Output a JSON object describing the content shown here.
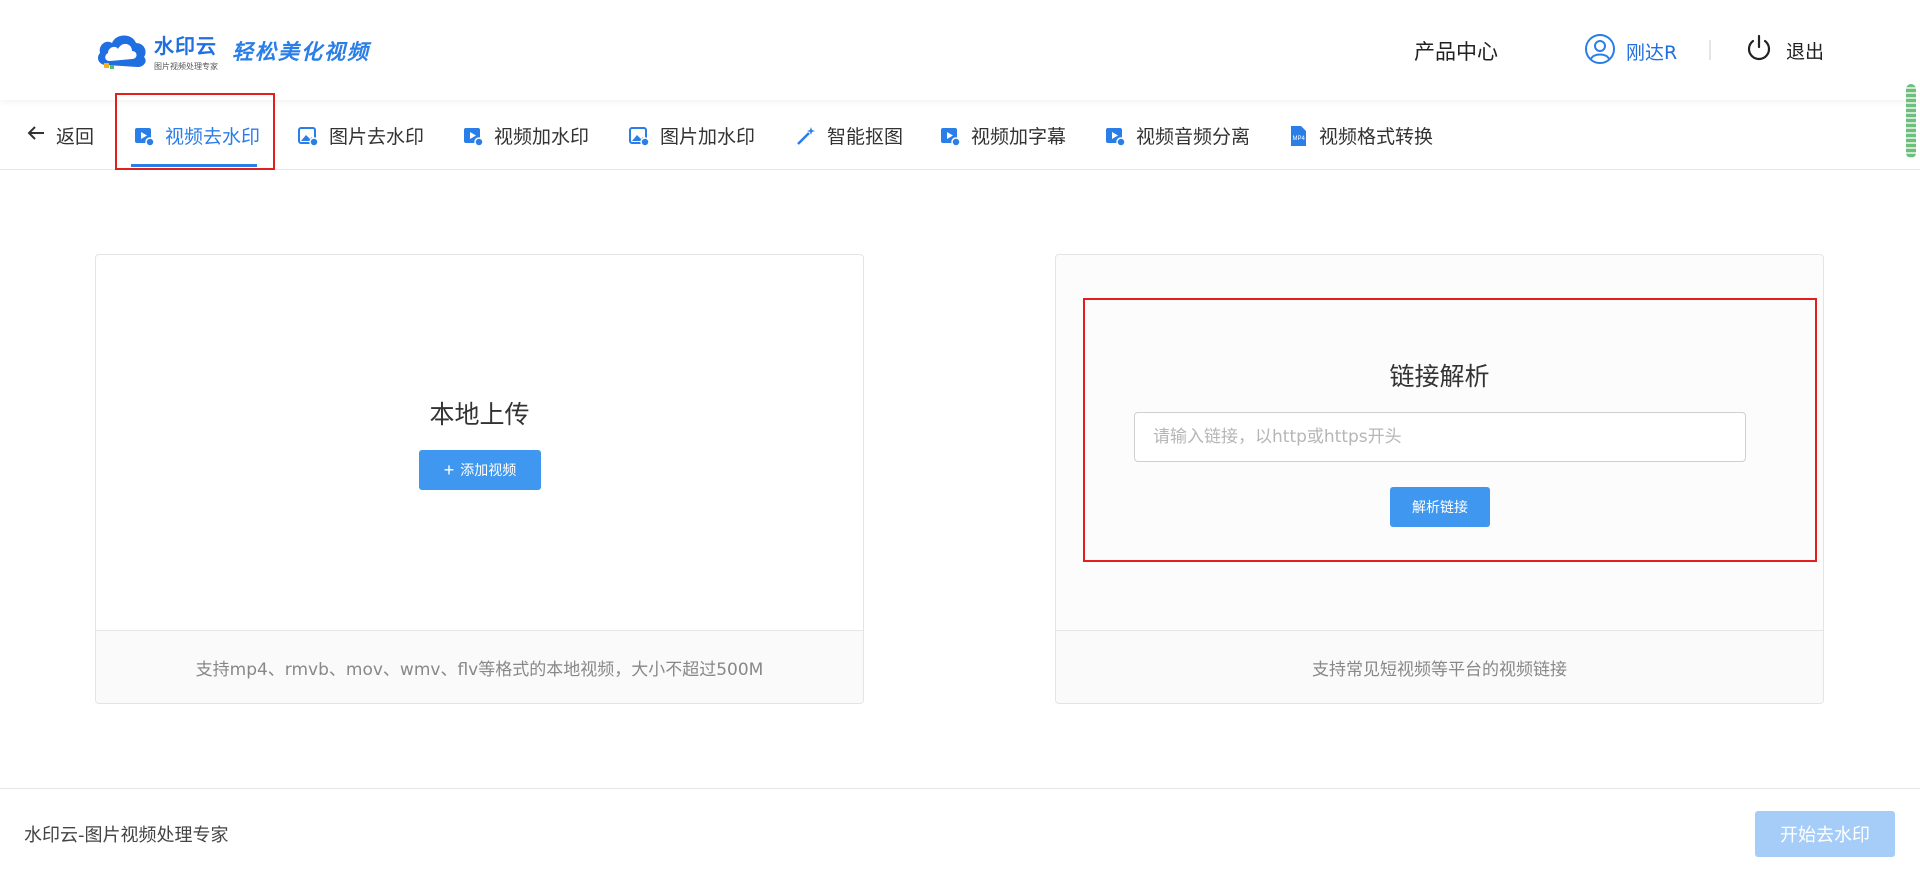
{
  "header": {
    "logo_name": "水印云",
    "logo_sub": "图片视频处理专家",
    "slogan": "轻松美化视频",
    "product_center": "产品中心",
    "username": "刚达R",
    "logout": "退出"
  },
  "tabs": {
    "back": "返回",
    "items": [
      {
        "label": "视频去水印",
        "icon": "video-icon",
        "active": true
      },
      {
        "label": "图片去水印",
        "icon": "image-icon"
      },
      {
        "label": "视频加水印",
        "icon": "video-add-icon"
      },
      {
        "label": "图片加水印",
        "icon": "image-add-icon"
      },
      {
        "label": "智能抠图",
        "icon": "magic-wand-icon"
      },
      {
        "label": "视频加字幕",
        "icon": "video-subtitle-icon"
      },
      {
        "label": "视频音频分离",
        "icon": "video-audio-icon"
      },
      {
        "label": "视频格式转换",
        "icon": "mp4-file-icon"
      }
    ]
  },
  "local_upload": {
    "title": "本地上传",
    "add_button": "添加视频",
    "note": "支持mp4、rmvb、mov、wmv、flv等格式的本地视频，大小不超过500M"
  },
  "link_parse": {
    "title": "链接解析",
    "placeholder": "请输入链接，以http或https开头",
    "value": "",
    "parse_button": "解析链接",
    "note": "支持常见短视频等平台的视频链接"
  },
  "footer": {
    "brand": "水印云-图片视频处理专家",
    "start_button": "开始去水印"
  },
  "colors": {
    "accent": "#2a7ee8",
    "button": "#3f97ef",
    "button_disabled": "#a6cdf7",
    "highlight": "#e31e1e"
  }
}
